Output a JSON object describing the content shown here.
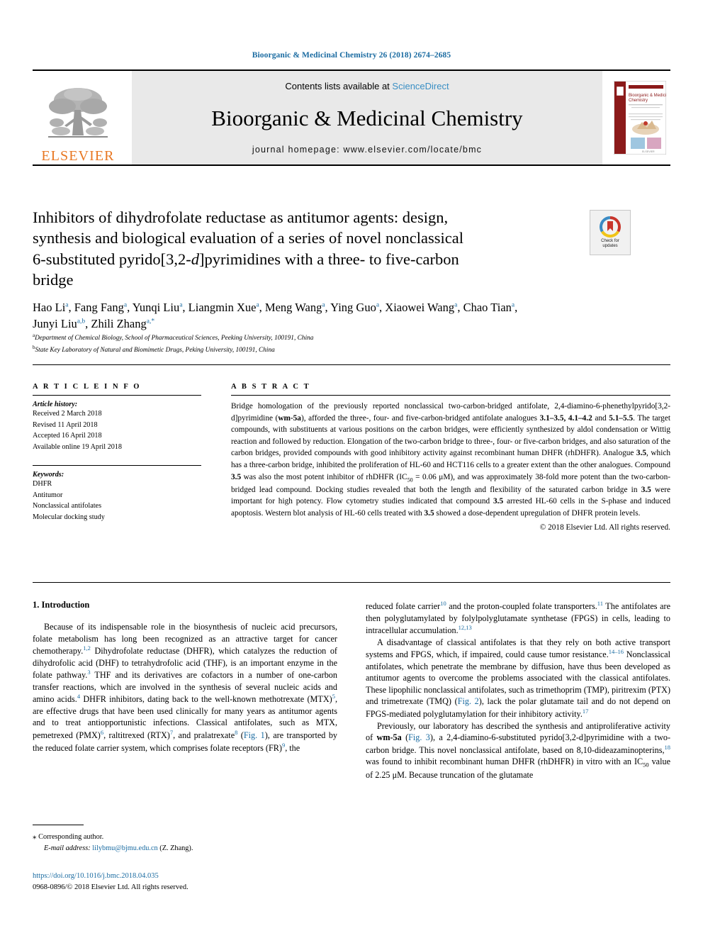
{
  "running_head": "Bioorganic & Medicinal Chemistry 26 (2018) 2674–2685",
  "masthead": {
    "publisher": "ELSEVIER",
    "contents_prefix": "Contents lists available at ",
    "contents_link": "ScienceDirect",
    "journal_name": "Bioorganic & Medicinal Chemistry",
    "homepage": "journal homepage: www.elsevier.com/locate/bmc",
    "cover_title_line1": "Bioorganic & Medicinal",
    "cover_title_line2": "Chemistry"
  },
  "crossmark": {
    "line1": "Check for",
    "line2": "updates"
  },
  "title": {
    "line1": "Inhibitors of dihydrofolate reductase as antitumor agents: design,",
    "line2": "synthesis and biological evaluation of a series of novel nonclassical",
    "line3_a": "6-substituted pyrido[3,2-",
    "line3_italic": "d",
    "line3_b": "]pyrimidines with a three- to five-carbon",
    "line4": "bridge"
  },
  "authors": {
    "line1": "Hao Li a, Fang Fang a, Yunqi Liu a, Liangmin Xue a, Meng Wang a, Ying Guo a, Xiaowei Wang a, Chao Tian a,",
    "line2": "Junyi Liu a,b, Zhili Zhang a,*",
    "list": [
      {
        "name": "Hao Li",
        "sup": "a"
      },
      {
        "name": "Fang Fang",
        "sup": "a"
      },
      {
        "name": "Yunqi Liu",
        "sup": "a"
      },
      {
        "name": "Liangmin Xue",
        "sup": "a"
      },
      {
        "name": "Meng Wang",
        "sup": "a"
      },
      {
        "name": "Ying Guo",
        "sup": "a"
      },
      {
        "name": "Xiaowei Wang",
        "sup": "a"
      },
      {
        "name": "Chao Tian",
        "sup": "a"
      },
      {
        "name": "Junyi Liu",
        "sup": "a,b"
      },
      {
        "name": "Zhili Zhang",
        "sup": "a,*"
      }
    ]
  },
  "affiliations": [
    {
      "marker": "a",
      "text": "Department of Chemical Biology, School of Pharmaceutical Sciences, Peeking University, 100191, China"
    },
    {
      "marker": "b",
      "text": "State Key Laboratory of Natural and Biomimetic Drugs, Peking University, 100191, China"
    }
  ],
  "article_info": {
    "heading": "A R T I C L E  I N F O",
    "history_label": "Article history:",
    "history": [
      "Received 2 March 2018",
      "Revised 11 April 2018",
      "Accepted 16 April 2018",
      "Available online 19 April 2018"
    ],
    "keywords_label": "Keywords:",
    "keywords": [
      "DHFR",
      "Antitumor",
      "Nonclassical antifolates",
      "Molecular docking study"
    ]
  },
  "abstract": {
    "heading": "A B S T R A C T",
    "p1_seg1": "Bridge homologation of the previously reported nonclassical two-carbon-bridged antifolate, 2,4-diamino-6-phenethylpyrido[3,2-d]pyrimidine (",
    "p1_bold1": "wm-5a",
    "p1_seg2": "), afforded the three-, four- and five-carbon-bridged antifolate analogues ",
    "p1_bold2": "3.1–3.5, 4.1–4.2",
    "p1_seg3": " and ",
    "p1_bold3": "5.1–5.5",
    "p1_seg4": ". The target compounds, with substituents at various positions on the carbon bridges, were efficiently synthesized by aldol condensation or Wittig reaction and followed by reduction. Elongation of the two-carbon bridge to three-, four- or five-carbon bridges, and also saturation of the carbon bridges, provided compounds with good inhibitory activity against recombinant human DHFR (rhDHFR). Analogue ",
    "p1_bold4": "3.5",
    "p1_seg5": ", which has a three-carbon bridge, inhibited the proliferation of HL-60 and HCT116 cells to a greater extent than the other analogues. Compound ",
    "p1_bold5": "3.5",
    "p1_seg6": " was also the most potent inhibitor of rhDHFR (IC",
    "p1_sub": "50",
    "p1_seg7": " = 0.06 μM), and was approximately 38-fold more potent than the two-carbon-bridged lead compound. Docking studies revealed that both the length and flexibility of the saturated carbon bridge in ",
    "p1_bold6": "3.5",
    "p1_seg8": " were important for high potency. Flow cytometry studies indicated that compound ",
    "p1_bold7": "3.5",
    "p1_seg9": " arrested HL-60 cells in the S-phase and induced apoptosis. Western blot analysis of HL-60 cells treated with ",
    "p1_bold8": "3.5",
    "p1_seg10": " showed a dose-dependent upregulation of DHFR protein levels.",
    "copyright": "© 2018 Elsevier Ltd. All rights reserved."
  },
  "introduction": {
    "heading": "1. Introduction",
    "left_p1_a": "Because of its indispensable role in the biosynthesis of nucleic acid precursors, folate metabolism has long been recognized as an attractive target for cancer chemotherapy.",
    "left_p1_ref1": "1,2",
    "left_p1_b": " Dihydrofolate reductase (DHFR), which catalyzes the reduction of dihydrofolic acid (DHF) to tetrahydrofolic acid (THF), is an important enzyme in the folate pathway.",
    "left_p1_ref2": "3",
    "left_p1_c": " THF and its derivatives are cofactors in a number of one-carbon transfer reactions, which are involved in the synthesis of several nucleic acids and amino acids.",
    "left_p1_ref3": "4",
    "left_p1_d": " DHFR inhibitors, dating back to the well-known methotrexate (MTX)",
    "left_p1_ref4": "5",
    "left_p1_e": ", are effective drugs that have been used clinically for many years as antitumor agents and to treat antiopportunistic infections. Classical antifolates, such as MTX, pemetrexed (PMX)",
    "left_p1_ref5": "6",
    "left_p1_f": ", raltitrexed (RTX)",
    "left_p1_ref6": "7",
    "left_p1_g": ", and pralatrexate",
    "left_p1_ref7": "8",
    "left_p1_h": " (",
    "left_p1_fig1": "Fig. 1",
    "left_p1_i": "), are transported by the reduced folate carrier system, which comprises folate receptors (FR)",
    "left_p1_ref8": "9",
    "left_p1_j": ", the",
    "right_p1_a": "reduced folate carrier",
    "right_p1_ref1": "10",
    "right_p1_b": " and the proton-coupled folate transporters.",
    "right_p1_ref2": "11",
    "right_p1_c": " The antifolates are then polyglutamylated by folylpolyglutamate synthetase (FPGS) in cells, leading to intracellular accumulation.",
    "right_p1_ref3": "12,13",
    "right_p2_a": "A disadvantage of classical antifolates is that they rely on both active transport systems and FPGS, which, if impaired, could cause tumor resistance.",
    "right_p2_ref1": "14–16",
    "right_p2_b": " Nonclassical antifolates, which penetrate the membrane by diffusion, have thus been developed as antitumor agents to overcome the problems associated with the classical antifolates. These lipophilic nonclassical antifolates, such as trimethoprim (TMP), piritrexim (PTX) and trimetrexate (TMQ) (",
    "right_p2_fig2": "Fig. 2",
    "right_p2_c": "), lack the polar glutamate tail and do not depend on FPGS-mediated polyglutamylation for their inhibitory activity.",
    "right_p2_ref2": "17",
    "right_p3_a": "Previously, our laboratory has described the synthesis and antiproliferative activity of ",
    "right_p3_bold": "wm-5a",
    "right_p3_b": " (",
    "right_p3_fig3": "Fig. 3",
    "right_p3_c": "), a 2,4-diamino-6-substituted pyrido[3,2-d]pyrimidine with a two-carbon bridge. This novel nonclassical antifolate, based on 8,10-dideazaminopterins,",
    "right_p3_ref1": "18",
    "right_p3_d": " was found to inhibit recombinant human DHFR (rhDHFR) in vitro with an IC",
    "right_p3_sub": "50",
    "right_p3_e": " value of 2.25 μM. Because truncation of the glutamate"
  },
  "footnote": {
    "star": "⁎",
    "corresponding": "Corresponding author.",
    "email_label": "E-mail address:",
    "email": "lilybmu@bjmu.edu.cn",
    "email_suffix": " (Z. Zhang)."
  },
  "doi_block": {
    "doi": "https://doi.org/10.1016/j.bmc.2018.04.035",
    "issn": "0968-0896/© 2018 Elsevier Ltd. All rights reserved."
  },
  "colors": {
    "link": "#1a6ba1",
    "elsevier_orange": "#E87722",
    "band_grey": "#e9e9e9",
    "crossmark_red": "#C8352B",
    "crossmark_yellow": "#F0C419",
    "crossmark_blue": "#3B8BC4"
  }
}
